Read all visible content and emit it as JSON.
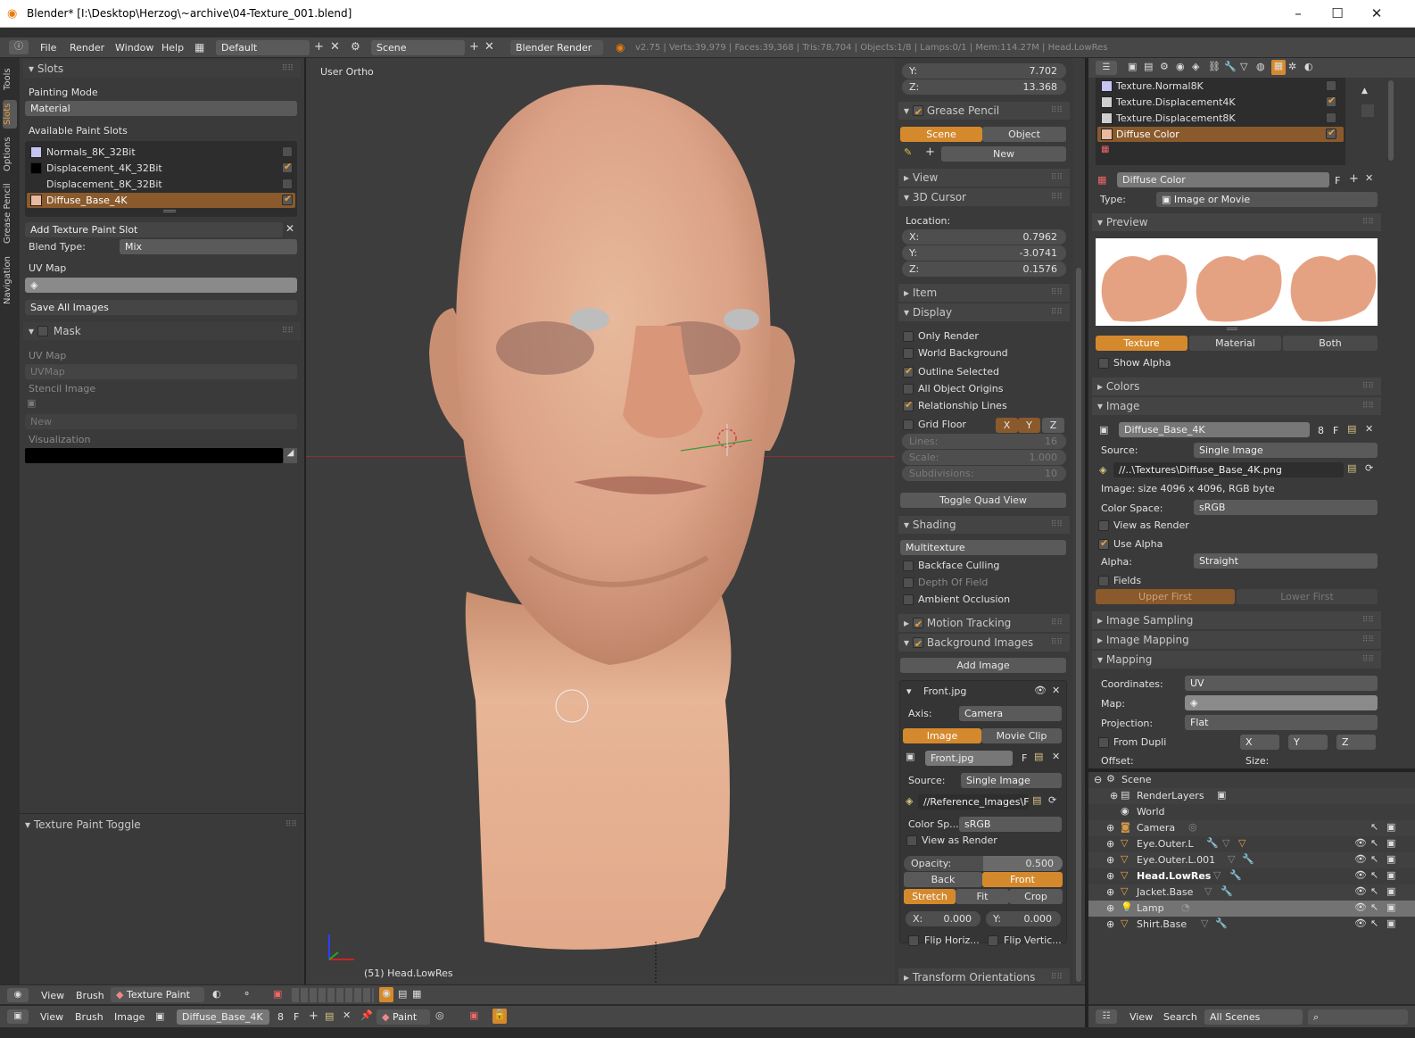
{
  "window": {
    "title": "Blender* [I:\\Desktop\\Herzog\\~archive\\04-Texture_001.blend]"
  },
  "menubar": {
    "items": [
      "File",
      "Render",
      "Window",
      "Help"
    ],
    "screen": "Default",
    "scene": "Scene",
    "engine": "Blender Render",
    "stats": "v2.75 | Verts:39,979 | Faces:39,368 | Tris:78,704 | Objects:1/8 | Lamps:0/1 | Mem:114.27M | Head.LowRes"
  },
  "lefttabs": [
    "Tools",
    "Slots",
    "Options",
    "Grease Pencil",
    "Navigation"
  ],
  "slots": {
    "header": "Slots",
    "painting_mode_label": "Painting Mode",
    "painting_mode": "Material",
    "available_label": "Available Paint Slots",
    "items": [
      {
        "name": "Normals_8K_32Bit",
        "color": "#c6c4f2",
        "checked": false
      },
      {
        "name": "Displacement_4K_32Bit",
        "color": "#000000",
        "checked": true
      },
      {
        "name": "Displacement_8K_32Bit",
        "color": "#3a3a3a",
        "checked": false
      },
      {
        "name": "Diffuse_Base_4K",
        "color": "#e9b9a0",
        "checked": true,
        "selected": true
      }
    ],
    "add_slot": "Add Texture Paint Slot",
    "blend_type_label": "Blend Type:",
    "blend_type": "Mix",
    "uvmap_label": "UV Map",
    "save_all": "Save All Images"
  },
  "mask": {
    "header": "Mask",
    "uvmap_label": "UV Map",
    "uvmap": "UVMap",
    "stencil_label": "Stencil Image",
    "new": "New",
    "visualization": "Visualization"
  },
  "texture_toggle": "Texture Paint Toggle",
  "viewport": {
    "label": "User Ortho",
    "object": "(51) Head.LowRes"
  },
  "viewport_header": {
    "view": "View",
    "brush": "Brush",
    "mode": "Texture Paint"
  },
  "image_header": {
    "view": "View",
    "brush": "Brush",
    "image": "Image",
    "name": "Diffuse_Base_4K",
    "users": "8",
    "f": "F",
    "paint": "Paint"
  },
  "npanel": {
    "y_label": "Y:",
    "y_val": "7.702",
    "z_label": "Z:",
    "z_val": "13.368",
    "grease_pencil": "Grease Pencil",
    "gp_scene": "Scene",
    "gp_object": "Object",
    "gp_new": "New",
    "view": "View",
    "cursor": "3D Cursor",
    "location": "Location:",
    "cx": "0.7962",
    "cy": "-3.0741",
    "cz": "0.1576",
    "item": "Item",
    "display": "Display",
    "only_render": "Only Render",
    "world_bg": "World Background",
    "outline": "Outline Selected",
    "all_origins": "All Object Origins",
    "rel_lines": "Relationship Lines",
    "grid_floor": "Grid Floor",
    "lines_label": "Lines:",
    "lines": "16",
    "scale_label": "Scale:",
    "scale": "1.000",
    "subdiv_label": "Subdivisions:",
    "subdiv": "10",
    "quad": "Toggle Quad View",
    "shading": "Shading",
    "shading_mode": "Multitexture",
    "backface": "Backface Culling",
    "dof": "Depth Of Field",
    "ao": "Ambient Occlusion",
    "motion": "Motion Tracking",
    "bg_images": "Background Images",
    "add_image": "Add Image",
    "front": "Front.jpg",
    "axis_label": "Axis:",
    "axis": "Camera",
    "bi_image": "Image",
    "bi_clip": "Movie Clip",
    "bi_file": "Front.jpg",
    "bi_f": "F",
    "source_label": "Source:",
    "source": "Single Image",
    "path": "//Reference_Images\\Fr...",
    "colorsp_label": "Color Sp...",
    "colorsp": "sRGB",
    "view_render": "View as Render",
    "opacity_label": "Opacity:",
    "opacity": "0.500",
    "back": "Back",
    "front_btn": "Front",
    "stretch": "Stretch",
    "fit": "Fit",
    "crop": "Crop",
    "ox": "0.000",
    "oy": "0.000",
    "fliph": "Flip Horiz...",
    "flipv": "Flip Vertic...",
    "transform": "Transform Orientations"
  },
  "props": {
    "textures": [
      {
        "name": "Texture.Normal8K",
        "color": "#c6c4f2"
      },
      {
        "name": "Texture.Displacement4K",
        "color": "#cfcfcf",
        "checked": true
      },
      {
        "name": "Texture.Displacement8K",
        "color": "#cfcfcf"
      },
      {
        "name": "Diffuse Color",
        "color": "#e9b9a0",
        "checked": true,
        "selected": true
      }
    ],
    "tex_name": "Diffuse Color",
    "type_label": "Type:",
    "type": "Image or Movie",
    "preview": "Preview",
    "tab_texture": "Texture",
    "tab_material": "Material",
    "tab_both": "Both",
    "show_alpha": "Show Alpha",
    "colors": "Colors",
    "image": "Image",
    "img_name": "Diffuse_Base_4K",
    "img_users": "8",
    "source_label": "Source:",
    "source": "Single Image",
    "path": "//..\\Textures\\Diffuse_Base_4K.png",
    "info": "Image: size 4096 x 4096, RGB byte",
    "colorspace_label": "Color Space:",
    "colorspace": "sRGB",
    "view_render": "View as Render",
    "use_alpha": "Use Alpha",
    "alpha_label": "Alpha:",
    "alpha": "Straight",
    "fields": "Fields",
    "upper": "Upper First",
    "lower": "Lower First",
    "sampling": "Image Sampling",
    "img_mapping": "Image Mapping",
    "mapping": "Mapping",
    "coords_label": "Coordinates:",
    "coords": "UV",
    "map_label": "Map:",
    "proj_label": "Projection:",
    "proj": "Flat",
    "from_dupli": "From Dupli",
    "x": "X",
    "y": "Y",
    "z": "Z",
    "offset": "Offset:",
    "size": "Size:"
  },
  "outliner": {
    "items": [
      {
        "name": "Scene",
        "indent": 0
      },
      {
        "name": "RenderLayers",
        "indent": 1
      },
      {
        "name": "World",
        "indent": 1
      },
      {
        "name": "Camera",
        "indent": 1
      },
      {
        "name": "Eye.Outer.L",
        "indent": 1
      },
      {
        "name": "Eye.Outer.L.001",
        "indent": 1
      },
      {
        "name": "Head.LowRes",
        "indent": 1,
        "bold": true
      },
      {
        "name": "Jacket.Base",
        "indent": 1
      },
      {
        "name": "Lamp",
        "indent": 1,
        "selected": true
      },
      {
        "name": "Shirt.Base",
        "indent": 1
      }
    ],
    "view": "View",
    "search": "Search",
    "scenes": "All Scenes"
  }
}
